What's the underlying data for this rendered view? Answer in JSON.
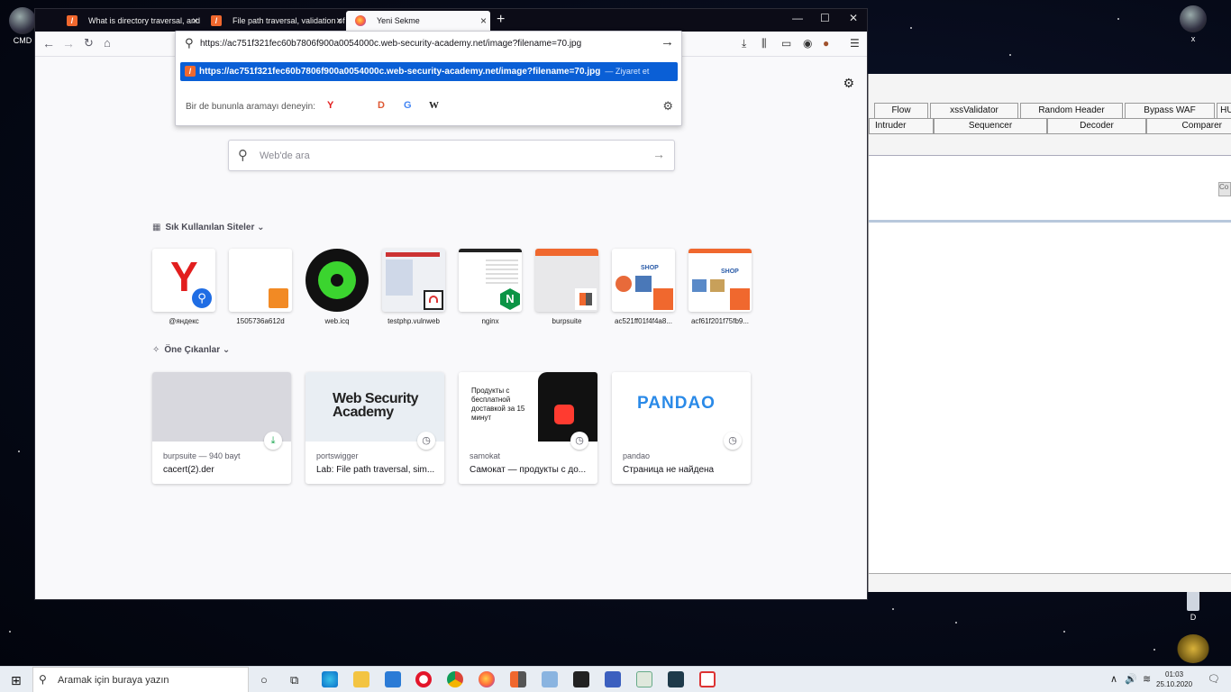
{
  "desktop": {
    "icon_cmd": "CMD",
    "icon_x": "x",
    "icon_d": "D"
  },
  "burp": {
    "tabs_row1": [
      "Flow",
      "xssValidator",
      "Random Header",
      "Bypass WAF",
      "HUN"
    ],
    "tabs_row2": [
      "Intruder",
      "Sequencer",
      "Decoder",
      "Comparer"
    ],
    "side_label": "Co"
  },
  "browser": {
    "tabs": [
      {
        "title": "What is directory traversal, and",
        "favicon": "portswigger-icon",
        "active": false
      },
      {
        "title": "File path traversal, validation of",
        "favicon": "portswigger-icon",
        "active": false
      },
      {
        "title": "Yeni Sekme",
        "favicon": "firefox-icon",
        "active": true
      }
    ],
    "url": "https://ac751f321fec60b7806f900a0054000c.web-security-academy.net/image?filename=70.jpg",
    "suggestion": {
      "url": "https://ac751f321fec60b7806f900a0054000c.web-security-academy.net/image?filename=70.jpg",
      "action": "— Ziyaret et"
    },
    "oneoff_label": "Bir de bununla aramayı deneyin:",
    "engines": [
      "Y",
      "D",
      "G",
      "W"
    ],
    "websearch_placeholder": "Web'de ara",
    "topsites_title": "Sık Kullanılan Siteler",
    "topsites": [
      {
        "label": "@яндекс"
      },
      {
        "label": "1505736a612d"
      },
      {
        "label": "web.icq"
      },
      {
        "label": "testphp.vulnweb"
      },
      {
        "label": "nginx"
      },
      {
        "label": "burpsuite"
      },
      {
        "label": "ac521ff01f4f4a8..."
      },
      {
        "label": "acf61f201f75fb9..."
      }
    ],
    "highlights_title": "Öne Çıkanlar",
    "highlights": [
      {
        "source": "burpsuite — 940 bayt",
        "title": "cacert(2).der",
        "badge": "download-icon"
      },
      {
        "source": "portswigger",
        "title": "Lab: File path traversal, sim...",
        "badge": "clock-icon",
        "thumb_text": "Web Security Academy"
      },
      {
        "source": "samokat",
        "title": "Самокат — продукты с до...",
        "badge": "clock-icon",
        "thumb_text": "Продукты с бесплатной доставкой за 15 минут"
      },
      {
        "source": "pandao",
        "title": "Страница не найдена",
        "badge": "clock-icon",
        "thumb_text": "PANDAO"
      }
    ]
  },
  "taskbar": {
    "search_placeholder": "Aramak için buraya yazın",
    "time": "01:03",
    "date": "25.10.2020"
  },
  "colors": {
    "accent_blue": "#0a5fd6",
    "portswigger_orange": "#f0682e",
    "titlebar": "#0c0c17"
  }
}
